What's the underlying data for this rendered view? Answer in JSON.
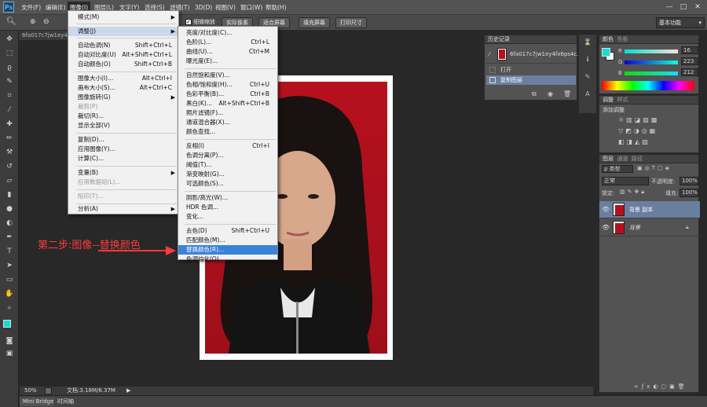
{
  "app": {
    "logo": "Ps"
  },
  "menubar": {
    "items": [
      "文件(F)",
      "编辑(E)",
      "图像(I)",
      "图层(L)",
      "文字(Y)",
      "选择(S)",
      "滤镜(T)",
      "3D(D)",
      "视图(V)",
      "窗口(W)",
      "帮助(H)"
    ],
    "active_index": 2,
    "minimize": "—",
    "maximize": "□",
    "close": "✕"
  },
  "options_bar": {
    "zoom_all_windows_checked": true,
    "zoom_all_windows_label": "细微缩放",
    "actual_pixels": "实际像素",
    "fit_screen": "适合屏幕",
    "fill_screen": "填充屏幕",
    "print_size": "打印尺寸",
    "workspace": "基本功能"
  },
  "document": {
    "tab_title": "6fa017c7jw1ey4fx",
    "zoom": "50%",
    "doc_info": "文档:3.18M/6.37M"
  },
  "bottom_tabs": {
    "mini_bridge": "Mini Bridge",
    "timeline": "时间轴"
  },
  "image_menu": {
    "items": [
      {
        "label": "模式(M)",
        "submenu": true
      },
      {
        "label": "调整(J)",
        "submenu": true,
        "highlighted": true
      },
      {
        "label": "自动色调(N)",
        "shortcut": "Shift+Ctrl+L"
      },
      {
        "label": "自动对比度(U)",
        "shortcut": "Alt+Shift+Ctrl+L"
      },
      {
        "label": "自动颜色(O)",
        "shortcut": "Shift+Ctrl+B"
      },
      {
        "label": "图像大小(I)...",
        "shortcut": "Alt+Ctrl+I"
      },
      {
        "label": "画布大小(S)...",
        "shortcut": "Alt+Ctrl+C"
      },
      {
        "label": "图像旋转(G)",
        "submenu": true
      },
      {
        "label": "裁剪(P)",
        "disabled": true
      },
      {
        "label": "裁切(R)..."
      },
      {
        "label": "显示全部(V)"
      },
      {
        "label": "复制(D)..."
      },
      {
        "label": "应用图像(Y)..."
      },
      {
        "label": "计算(C)..."
      },
      {
        "label": "变量(B)",
        "submenu": true
      },
      {
        "label": "应用数据组(L)...",
        "disabled": true
      },
      {
        "label": "陷印(T)...",
        "disabled": true
      },
      {
        "label": "分析(A)",
        "submenu": true
      }
    ]
  },
  "adjust_menu": {
    "items": [
      {
        "label": "亮度/对比度(C)..."
      },
      {
        "label": "色阶(L)...",
        "shortcut": "Ctrl+L"
      },
      {
        "label": "曲线(U)...",
        "shortcut": "Ctrl+M"
      },
      {
        "label": "曝光度(E)..."
      },
      {
        "label": "自然饱和度(V)..."
      },
      {
        "label": "色相/饱和度(H)...",
        "shortcut": "Ctrl+U"
      },
      {
        "label": "色彩平衡(B)...",
        "shortcut": "Ctrl+B"
      },
      {
        "label": "黑白(K)...",
        "shortcut": "Alt+Shift+Ctrl+B"
      },
      {
        "label": "照片滤镜(F)..."
      },
      {
        "label": "通道混合器(X)..."
      },
      {
        "label": "颜色查找..."
      },
      {
        "label": "反相(I)",
        "shortcut": "Ctrl+I"
      },
      {
        "label": "色调分离(P)..."
      },
      {
        "label": "阈值(T)..."
      },
      {
        "label": "渐变映射(G)..."
      },
      {
        "label": "可选颜色(S)..."
      },
      {
        "label": "阴影/高光(W)..."
      },
      {
        "label": "HDR 色调..."
      },
      {
        "label": "变化..."
      },
      {
        "label": "去色(D)",
        "shortcut": "Shift+Ctrl+U"
      },
      {
        "label": "匹配颜色(M)..."
      },
      {
        "label": "替换颜色(R)...",
        "highlighted": true
      },
      {
        "label": "色调均化(Q)"
      }
    ]
  },
  "annotation": {
    "text": "第二步:图像--替换颜色",
    "color": "#ff3a3a"
  },
  "history_panel": {
    "title": "历史记录",
    "snapshot": "6fa017c7jw1ey4fx6ps4c...",
    "states": [
      "打开",
      "复制图层"
    ],
    "selected_index": 1
  },
  "color_panel": {
    "tabs": [
      "颜色",
      "色板"
    ],
    "r_label": "R",
    "g_label": "G",
    "b_label": "B",
    "r": "16",
    "g": "223",
    "b": "212",
    "foreground": "#10dfd4"
  },
  "adjustments_panel": {
    "tabs": [
      "调整",
      "样式"
    ],
    "add_label": "添加调整"
  },
  "layers_panel": {
    "tabs": [
      "图层",
      "通道",
      "路径"
    ],
    "filter_label": "ρ 类型",
    "blend_mode": "正常",
    "opacity_label": "不透明度:",
    "opacity": "100%",
    "lock_label": "锁定:",
    "fill_label": "填充:",
    "fill": "100%",
    "layers": [
      {
        "name": "背景 副本",
        "selected": true
      },
      {
        "name": "背景",
        "locked": true
      }
    ]
  },
  "colors": {
    "accent": "#3b82d9",
    "canvas_red": "#b5111d"
  }
}
